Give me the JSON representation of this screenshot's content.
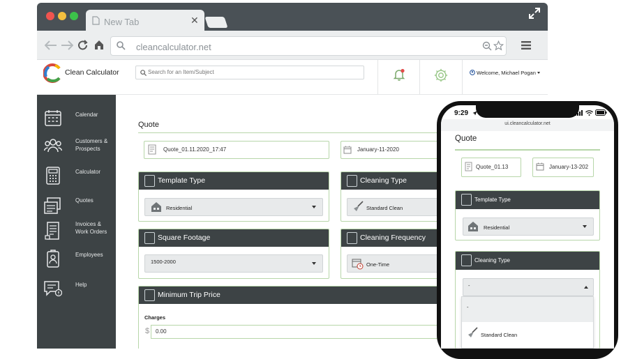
{
  "browser": {
    "tab_title": "New Tab",
    "url": "cleancalculator.net"
  },
  "app": {
    "brand": "Clean Calculator",
    "search_placeholder": "Search for an Item/Subject",
    "welcome": "Welcome, Michael Pogan"
  },
  "sidebar": {
    "items": [
      {
        "label": "Calendar"
      },
      {
        "label": "Customers &",
        "label2": "Prospects"
      },
      {
        "label": "Calculator"
      },
      {
        "label": "Quotes"
      },
      {
        "label": "Invoices &",
        "label2": "Work Orders"
      },
      {
        "label": "Employees"
      },
      {
        "label": "Help"
      }
    ]
  },
  "quote": {
    "title": "Quote",
    "quote_id": "Quote_01.11.2020_17:47",
    "date": "January-11-2020",
    "template_type": {
      "label": "Template Type",
      "value": "Residential"
    },
    "cleaning_type": {
      "label": "Cleaning Type",
      "value": "Standard Clean"
    },
    "square_footage": {
      "label": "Square Footage",
      "value": "1500-2000"
    },
    "cleaning_frequency": {
      "label": "Cleaning Frequency",
      "value": "One-Time"
    },
    "min_trip": {
      "label": "Minimum Trip Price",
      "charges_label": "Charges",
      "currency": "$",
      "value": "0.00"
    }
  },
  "phone": {
    "time": "9:29",
    "url": "ui.cleancalculator.net",
    "title": "Quote",
    "quote_id": "Quote_01.13",
    "date": "January-13-202",
    "template_type": {
      "label": "Template Type",
      "value": "Residential"
    },
    "cleaning_type": {
      "label": "Cleaning Type",
      "value": "-"
    },
    "options": [
      "-",
      "Standard Clean"
    ]
  },
  "colors": {
    "dark": "#3d4345",
    "accent_green": "#b7d6a9",
    "bell_red": "#e34b4b"
  }
}
